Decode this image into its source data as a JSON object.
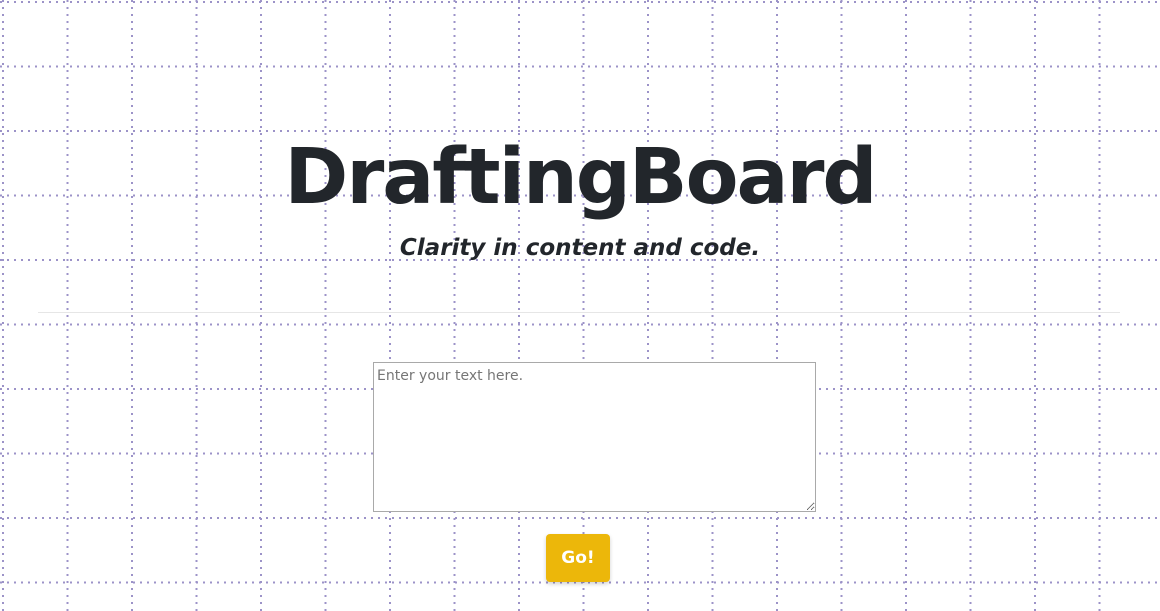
{
  "header": {
    "title": "DraftingBoard",
    "tagline": "Clarity in content and code."
  },
  "editor": {
    "placeholder": "Enter your text here.",
    "value": ""
  },
  "actions": {
    "go_label": "Go!"
  },
  "theme": {
    "grid_dot_color": "#9c93c8",
    "title_color": "#22262b",
    "button_color": "#ecb70a",
    "button_text_color": "#ffffff",
    "background_color": "#ffffff"
  }
}
